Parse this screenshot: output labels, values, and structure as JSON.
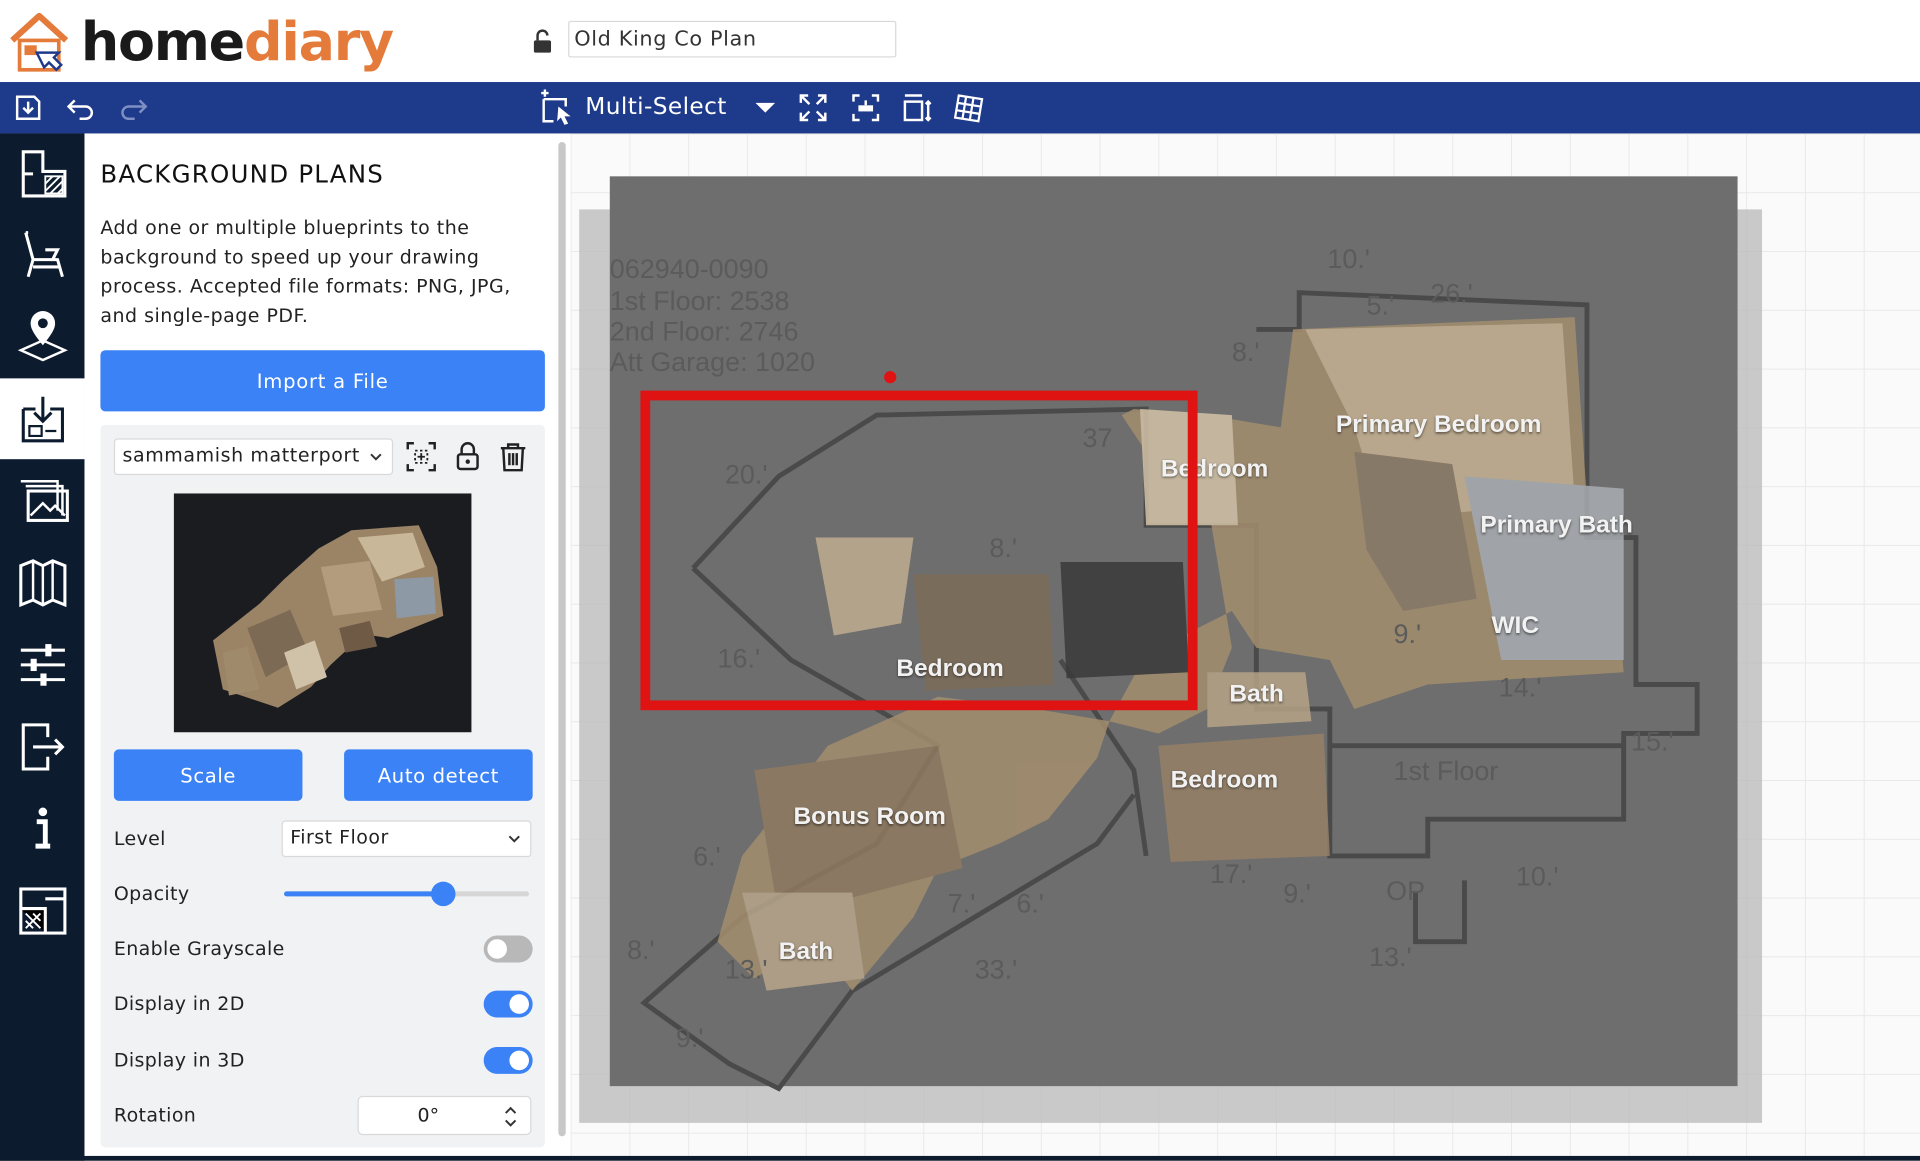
{
  "app": {
    "logo_part1": "home",
    "logo_part2": "diary",
    "plan_name": "Old King Co Plan",
    "brand_color": "#e57b3a",
    "toolbar_color": "#1e3a8a",
    "accent_color": "#3b82f6"
  },
  "toolbar": {
    "multi_select_label": "Multi-Select",
    "icons": [
      "save-icon",
      "undo-icon",
      "redo-icon",
      "multi-select-icon",
      "dropdown-caret-icon",
      "fit-screen-icon",
      "center-icon",
      "dimensions-icon",
      "grid-icon"
    ]
  },
  "rail": {
    "icons": [
      "floor-plan-icon",
      "furniture-icon",
      "location-icon",
      "background-plans-icon",
      "gallery-icon",
      "catalog-icon",
      "settings-sliders-icon",
      "export-icon",
      "info-icon",
      "layout-icon"
    ],
    "active_index": 3
  },
  "panel": {
    "title": "BACKGROUND PLANS",
    "description": "Add one or multiple blueprints to the background to speed up your drawing process. Accepted file formats: PNG, JPG, and single-page PDF.",
    "import_button": "Import a File",
    "selected_plan": "sammamish matterport",
    "scale_button": "Scale",
    "auto_detect_button": "Auto detect",
    "level_label": "Level",
    "level_value": "First Floor",
    "opacity_label": "Opacity",
    "opacity_value": 0.65,
    "grayscale_label": "Enable Grayscale",
    "grayscale_on": false,
    "display2d_label": "Display in 2D",
    "display2d_on": true,
    "display3d_label": "Display in 3D",
    "display3d_on": true,
    "rotation_label": "Rotation",
    "rotation_value": "0°"
  },
  "canvas": {
    "rooms": {
      "primary_bedroom": "Primary Bedroom",
      "bedroom_top": "Bedroom",
      "primary_bath": "Primary Bath",
      "wic": "WIC",
      "bedroom_mid": "Bedroom",
      "bath_mid": "Bath",
      "bedroom_right": "Bedroom",
      "bonus_room": "Bonus Room",
      "bath_bottom": "Bath"
    },
    "blueprint_text": {
      "parcel": "062940-0090",
      "floor1": "1st Floor:     2538",
      "floor2": "2nd Floor:    2746",
      "garage": "Att Garage:   1020",
      "first_floor": "1st Floor",
      "op": "OP",
      "dims": [
        "10.'",
        "26.'",
        "5.'",
        "8.'",
        "37",
        "20.'",
        "16.'",
        "8.'",
        "9.'",
        "14.'",
        "15.'",
        "17.'",
        "10.'",
        "9.'",
        "13.'",
        "7.'",
        "6.'",
        "33.'",
        "8.'",
        "13.'",
        "9.'",
        "6.'"
      ]
    }
  }
}
